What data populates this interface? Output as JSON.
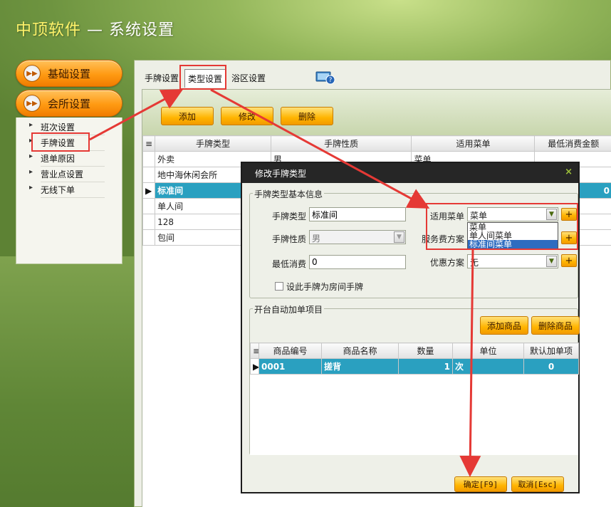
{
  "app": {
    "brand": "中顶软件",
    "dash": "—",
    "title": "系统设置"
  },
  "nav": {
    "basic_settings": "基础设置",
    "club_settings": "会所设置",
    "items": [
      "班次设置",
      "手牌设置",
      "退单原因",
      "营业点设置",
      "无线下单"
    ]
  },
  "tabs": [
    "手牌设置",
    "类型设置",
    "浴区设置"
  ],
  "toolbar": {
    "add": "添加",
    "edit": "修改",
    "delete": "删除"
  },
  "grid": {
    "columns": [
      "手牌类型",
      "手牌性质",
      "适用菜单",
      "最低消费金额"
    ],
    "rows": [
      {
        "type": "外卖",
        "nature": "男",
        "menu": "菜单",
        "min": ""
      },
      {
        "type": "地中海休闲会所",
        "nature": "",
        "menu": "",
        "min": ""
      },
      {
        "type": "标准间",
        "nature": "",
        "menu": "",
        "min": "0",
        "selected": true
      },
      {
        "type": "单人间",
        "nature": "",
        "menu": "",
        "min": ""
      },
      {
        "type": "128",
        "nature": "",
        "menu": "",
        "min": ""
      },
      {
        "type": "包间",
        "nature": "",
        "menu": "",
        "min": ""
      }
    ]
  },
  "dialog": {
    "title": "修改手牌类型",
    "close": "×",
    "section_basic": "手牌类型基本信息",
    "label_type": "手牌类型",
    "value_type": "标准间",
    "label_nature": "手牌性质",
    "value_nature": "男",
    "label_min": "最低消费",
    "value_min": "0",
    "label_menu": "适用菜单",
    "value_menu": "菜单",
    "label_service": "服务费方案",
    "label_discount": "优惠方案",
    "value_discount": "无",
    "checkbox_label": "设此手牌为房间手牌",
    "menu_options": [
      "菜单",
      "单人间菜单",
      "标准间菜单"
    ],
    "section_auto": "开台自动加单项目",
    "add_goods": "添加商品",
    "delete_goods": "删除商品",
    "goods_columns": [
      "商品编号",
      "商品名称",
      "数量",
      "单位",
      "默认加单项"
    ],
    "goods_rows": [
      {
        "code": "0001",
        "name": "搓背",
        "qty": "1",
        "unit": "次",
        "default": "0"
      }
    ],
    "confirm": "确定[F9]",
    "cancel": "取消[Esc]"
  },
  "colors": {
    "accent_orange": "#ffb400",
    "selection": "#2aa0c0",
    "annotation_red": "#e53935"
  }
}
